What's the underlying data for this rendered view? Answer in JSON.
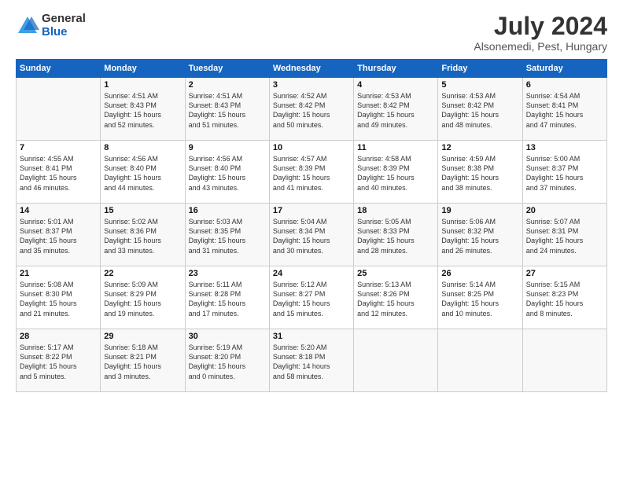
{
  "header": {
    "logo_general": "General",
    "logo_blue": "Blue",
    "month_title": "July 2024",
    "location": "Alsonemedi, Pest, Hungary"
  },
  "days_of_week": [
    "Sunday",
    "Monday",
    "Tuesday",
    "Wednesday",
    "Thursday",
    "Friday",
    "Saturday"
  ],
  "weeks": [
    [
      {
        "day": "",
        "info": ""
      },
      {
        "day": "1",
        "info": "Sunrise: 4:51 AM\nSunset: 8:43 PM\nDaylight: 15 hours\nand 52 minutes."
      },
      {
        "day": "2",
        "info": "Sunrise: 4:51 AM\nSunset: 8:43 PM\nDaylight: 15 hours\nand 51 minutes."
      },
      {
        "day": "3",
        "info": "Sunrise: 4:52 AM\nSunset: 8:42 PM\nDaylight: 15 hours\nand 50 minutes."
      },
      {
        "day": "4",
        "info": "Sunrise: 4:53 AM\nSunset: 8:42 PM\nDaylight: 15 hours\nand 49 minutes."
      },
      {
        "day": "5",
        "info": "Sunrise: 4:53 AM\nSunset: 8:42 PM\nDaylight: 15 hours\nand 48 minutes."
      },
      {
        "day": "6",
        "info": "Sunrise: 4:54 AM\nSunset: 8:41 PM\nDaylight: 15 hours\nand 47 minutes."
      }
    ],
    [
      {
        "day": "7",
        "info": "Sunrise: 4:55 AM\nSunset: 8:41 PM\nDaylight: 15 hours\nand 46 minutes."
      },
      {
        "day": "8",
        "info": "Sunrise: 4:56 AM\nSunset: 8:40 PM\nDaylight: 15 hours\nand 44 minutes."
      },
      {
        "day": "9",
        "info": "Sunrise: 4:56 AM\nSunset: 8:40 PM\nDaylight: 15 hours\nand 43 minutes."
      },
      {
        "day": "10",
        "info": "Sunrise: 4:57 AM\nSunset: 8:39 PM\nDaylight: 15 hours\nand 41 minutes."
      },
      {
        "day": "11",
        "info": "Sunrise: 4:58 AM\nSunset: 8:39 PM\nDaylight: 15 hours\nand 40 minutes."
      },
      {
        "day": "12",
        "info": "Sunrise: 4:59 AM\nSunset: 8:38 PM\nDaylight: 15 hours\nand 38 minutes."
      },
      {
        "day": "13",
        "info": "Sunrise: 5:00 AM\nSunset: 8:37 PM\nDaylight: 15 hours\nand 37 minutes."
      }
    ],
    [
      {
        "day": "14",
        "info": "Sunrise: 5:01 AM\nSunset: 8:37 PM\nDaylight: 15 hours\nand 35 minutes."
      },
      {
        "day": "15",
        "info": "Sunrise: 5:02 AM\nSunset: 8:36 PM\nDaylight: 15 hours\nand 33 minutes."
      },
      {
        "day": "16",
        "info": "Sunrise: 5:03 AM\nSunset: 8:35 PM\nDaylight: 15 hours\nand 31 minutes."
      },
      {
        "day": "17",
        "info": "Sunrise: 5:04 AM\nSunset: 8:34 PM\nDaylight: 15 hours\nand 30 minutes."
      },
      {
        "day": "18",
        "info": "Sunrise: 5:05 AM\nSunset: 8:33 PM\nDaylight: 15 hours\nand 28 minutes."
      },
      {
        "day": "19",
        "info": "Sunrise: 5:06 AM\nSunset: 8:32 PM\nDaylight: 15 hours\nand 26 minutes."
      },
      {
        "day": "20",
        "info": "Sunrise: 5:07 AM\nSunset: 8:31 PM\nDaylight: 15 hours\nand 24 minutes."
      }
    ],
    [
      {
        "day": "21",
        "info": "Sunrise: 5:08 AM\nSunset: 8:30 PM\nDaylight: 15 hours\nand 21 minutes."
      },
      {
        "day": "22",
        "info": "Sunrise: 5:09 AM\nSunset: 8:29 PM\nDaylight: 15 hours\nand 19 minutes."
      },
      {
        "day": "23",
        "info": "Sunrise: 5:11 AM\nSunset: 8:28 PM\nDaylight: 15 hours\nand 17 minutes."
      },
      {
        "day": "24",
        "info": "Sunrise: 5:12 AM\nSunset: 8:27 PM\nDaylight: 15 hours\nand 15 minutes."
      },
      {
        "day": "25",
        "info": "Sunrise: 5:13 AM\nSunset: 8:26 PM\nDaylight: 15 hours\nand 12 minutes."
      },
      {
        "day": "26",
        "info": "Sunrise: 5:14 AM\nSunset: 8:25 PM\nDaylight: 15 hours\nand 10 minutes."
      },
      {
        "day": "27",
        "info": "Sunrise: 5:15 AM\nSunset: 8:23 PM\nDaylight: 15 hours\nand 8 minutes."
      }
    ],
    [
      {
        "day": "28",
        "info": "Sunrise: 5:17 AM\nSunset: 8:22 PM\nDaylight: 15 hours\nand 5 minutes."
      },
      {
        "day": "29",
        "info": "Sunrise: 5:18 AM\nSunset: 8:21 PM\nDaylight: 15 hours\nand 3 minutes."
      },
      {
        "day": "30",
        "info": "Sunrise: 5:19 AM\nSunset: 8:20 PM\nDaylight: 15 hours\nand 0 minutes."
      },
      {
        "day": "31",
        "info": "Sunrise: 5:20 AM\nSunset: 8:18 PM\nDaylight: 14 hours\nand 58 minutes."
      },
      {
        "day": "",
        "info": ""
      },
      {
        "day": "",
        "info": ""
      },
      {
        "day": "",
        "info": ""
      }
    ]
  ]
}
